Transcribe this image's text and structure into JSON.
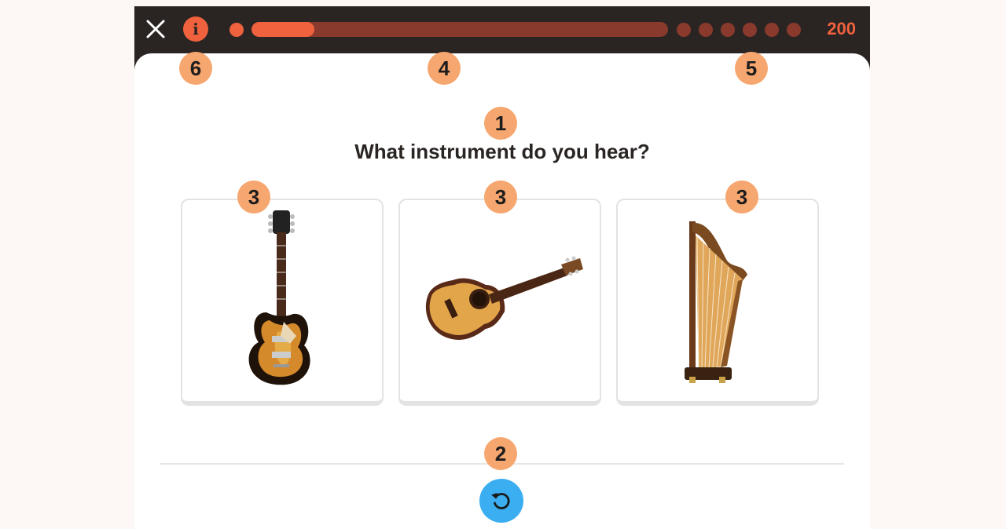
{
  "topbar": {
    "info_label": "i",
    "progress": 0.15,
    "score": "200",
    "remaining_steps": 6
  },
  "question": "What instrument do you hear?",
  "options": [
    {
      "instrument": "electric guitar"
    },
    {
      "instrument": "acoustic guitar"
    },
    {
      "instrument": "harp"
    }
  ],
  "markers": [
    "1",
    "2",
    "3",
    "3",
    "3",
    "4",
    "5",
    "6"
  ],
  "colors": {
    "accent": "#f0613d",
    "track": "#8a3a2c",
    "replay": "#3aaef0",
    "marker": "#f6a66f",
    "bar": "#2a2523"
  }
}
